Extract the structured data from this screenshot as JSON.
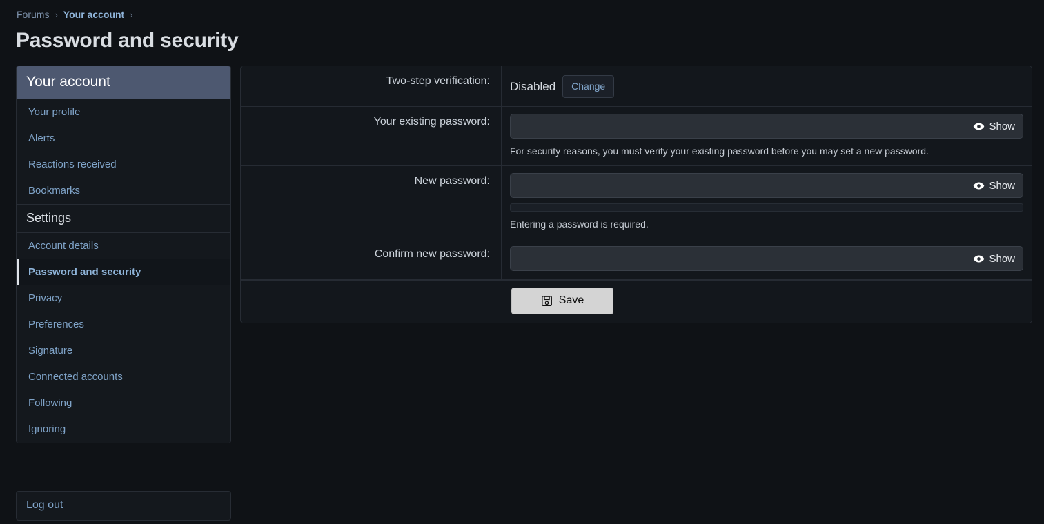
{
  "breadcrumb": {
    "items": [
      {
        "label": "Forums",
        "current": false
      },
      {
        "label": "Your account",
        "current": true
      }
    ],
    "separator": "›"
  },
  "page": {
    "title": "Password and security"
  },
  "sidebar": {
    "header": "Your account",
    "account_items": [
      {
        "label": "Your profile"
      },
      {
        "label": "Alerts"
      },
      {
        "label": "Reactions received"
      },
      {
        "label": "Bookmarks"
      }
    ],
    "settings_heading": "Settings",
    "settings_items": [
      {
        "label": "Account details",
        "active": false
      },
      {
        "label": "Password and security",
        "active": true
      },
      {
        "label": "Privacy",
        "active": false
      },
      {
        "label": "Preferences",
        "active": false
      },
      {
        "label": "Signature",
        "active": false
      },
      {
        "label": "Connected accounts",
        "active": false
      },
      {
        "label": "Following",
        "active": false
      },
      {
        "label": "Ignoring",
        "active": false
      }
    ],
    "logout_label": "Log out"
  },
  "form": {
    "two_step": {
      "label": "Two-step verification:",
      "status": "Disabled",
      "change_label": "Change"
    },
    "existing_password": {
      "label": "Your existing password:",
      "value": "",
      "placeholder": "",
      "show_label": "Show",
      "hint": "For security reasons, you must verify your existing password before you may set a new password."
    },
    "new_password": {
      "label": "New password:",
      "value": "",
      "placeholder": "",
      "show_label": "Show",
      "strength_percent": 0,
      "hint": "Entering a password is required."
    },
    "confirm_password": {
      "label": "Confirm new password:",
      "value": "",
      "placeholder": "",
      "show_label": "Show"
    },
    "save_label": "Save"
  },
  "colors": {
    "page_background": "#0f1216",
    "panel_background": "#13171c",
    "panel_border": "#272c34",
    "sidebar_header": "#4d5870",
    "link": "#7fa3c8",
    "active_link": "#8fb4d9",
    "input_background": "#2b3037",
    "save_button": "#d4d4d4",
    "text_primary": "#d9dde2"
  }
}
